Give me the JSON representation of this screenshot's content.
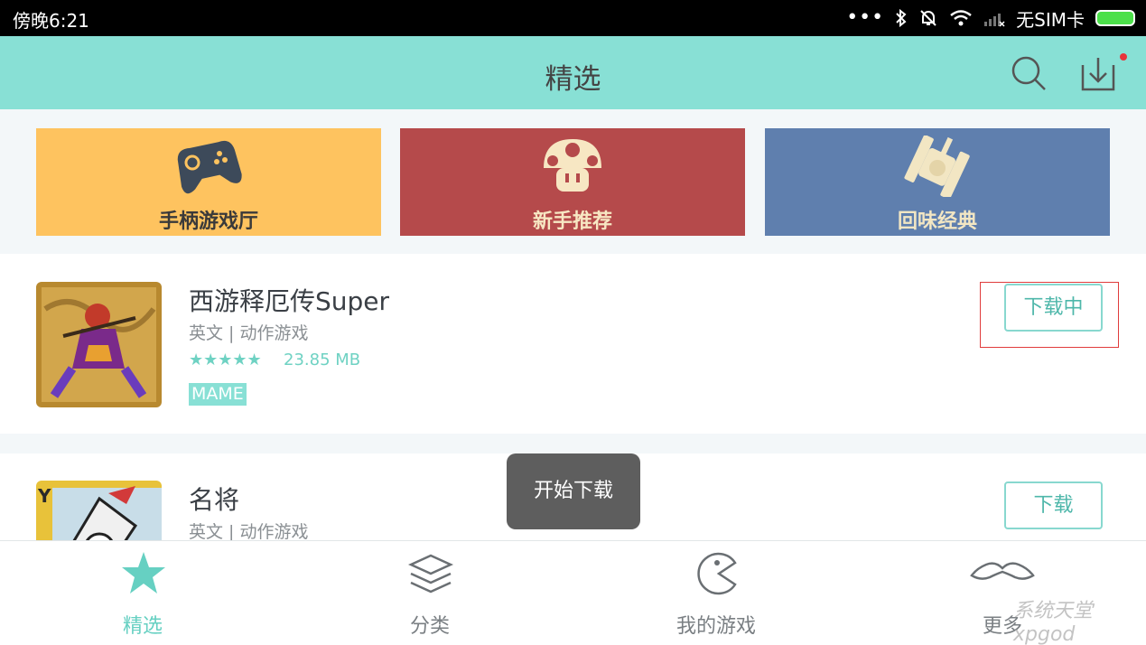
{
  "status_bar": {
    "time": "傍晚6:21",
    "carrier": "无SIM卡"
  },
  "header": {
    "title": "精选"
  },
  "banners": [
    {
      "label": "手柄游戏厅",
      "color": "#fec35f",
      "label_color": "#3a3a3a"
    },
    {
      "label": "新手推荐",
      "color": "#b54a4b",
      "label_color": "#f7e7c3"
    },
    {
      "label": "回味经典",
      "color": "#5f7fae",
      "label_color": "#f2e6c3"
    }
  ],
  "games": [
    {
      "name": "西游释厄传Super",
      "meta": "英文 | 动作游戏",
      "stars": "★★★★★",
      "size": "23.85 MB",
      "tag": "MAME",
      "button": "下载中"
    },
    {
      "name": "名将",
      "meta": "英文 | 动作游戏",
      "button": "下载"
    }
  ],
  "toast": "开始下载",
  "nav": [
    {
      "label": "精选",
      "icon": "star-icon",
      "active": true
    },
    {
      "label": "分类",
      "icon": "layers-icon",
      "active": false
    },
    {
      "label": "我的游戏",
      "icon": "pacman-icon",
      "active": false
    },
    {
      "label": "更多",
      "icon": "mustache-icon",
      "active": false
    }
  ],
  "watermark": "系统天堂 xpgod"
}
